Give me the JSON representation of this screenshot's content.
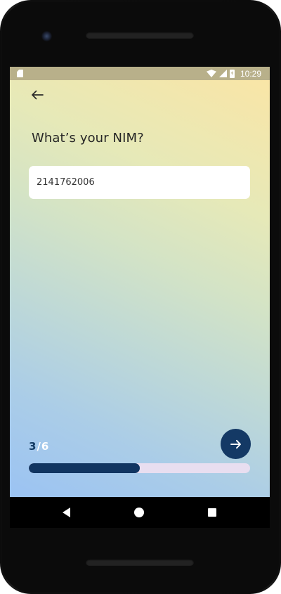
{
  "status_bar": {
    "time": "10:29",
    "icons": [
      "sd-card-icon",
      "wifi-icon",
      "signal-icon",
      "battery-charging-icon"
    ]
  },
  "header": {
    "back_icon": "arrow-left-icon"
  },
  "form": {
    "question": "What’s your NIM?",
    "nim_value": "2141762006"
  },
  "progress": {
    "current": "3",
    "separator": "/",
    "total": "6",
    "fraction": 0.5
  },
  "next_button": {
    "icon": "arrow-right-icon"
  },
  "nav_bar": {
    "icons": [
      "back-triangle-icon",
      "home-circle-icon",
      "recents-square-icon"
    ]
  },
  "colors": {
    "primary": "#143965",
    "progress_track": "#e8def0",
    "text": "#262626",
    "gradient_top": "#fbe5a5",
    "gradient_bottom": "#9bc3f3"
  }
}
